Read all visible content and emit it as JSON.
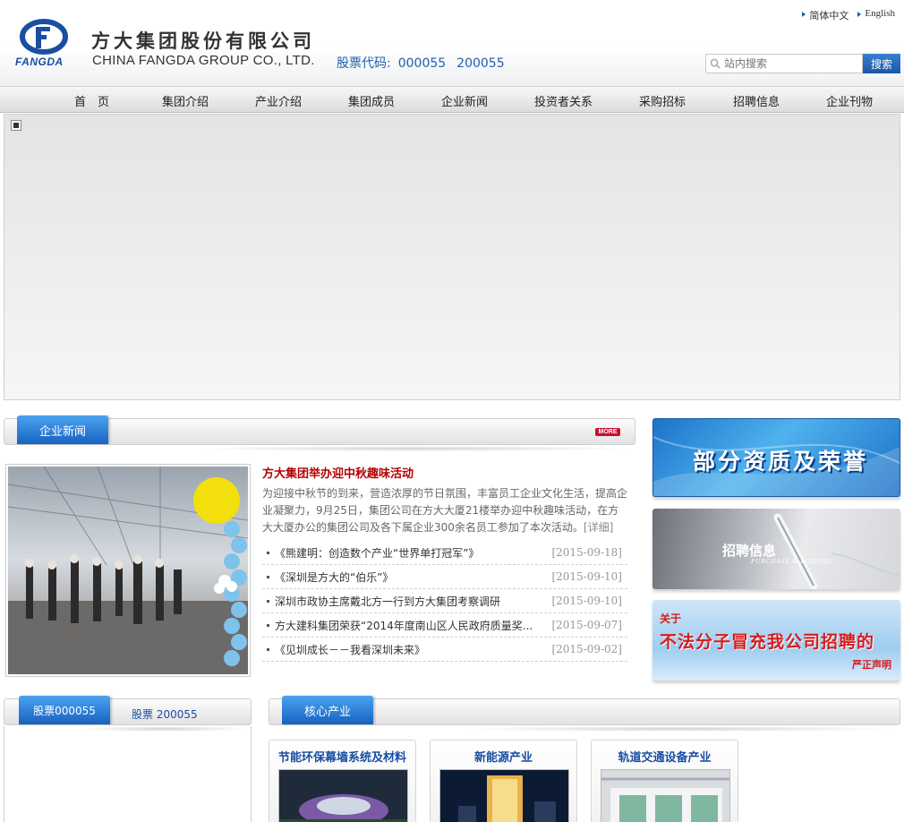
{
  "header": {
    "logo_text": "FANGDA",
    "company_cn": "方大集团股份有限公司",
    "company_en": "CHINA FANGDA GROUP CO., LTD.",
    "stock_label": "股票代码:",
    "stock_a": "000055",
    "stock_b": "200055",
    "lang_cn": "简体中文",
    "lang_en": "English",
    "search_placeholder": "站内搜索",
    "search_button": "搜索",
    "brand_color": "#1a4ea1"
  },
  "nav": {
    "items": [
      "首　页",
      "集团介绍",
      "产业介绍",
      "集团成员",
      "企业新闻",
      "投资者关系",
      "采购招标",
      "招聘信息",
      "企业刊物"
    ]
  },
  "news": {
    "section_title": "企业新闻",
    "more": "MORE",
    "headline": "方大集团举办迎中秋趣味活动",
    "summary": "为迎接中秋节的到来，营造浓厚的节日氛围，丰富员工企业文化生活，提高企业凝聚力，9月25日，集团公司在方大大厦21楼举办迎中秋趣味活动，在方大大厦办公的集团公司及各下属企业300余名员工参加了本次活动。",
    "detail": "[详细]",
    "items": [
      {
        "title": "《熊建明：创造数个产业“世界单打冠军”》",
        "date": "[2015-09-18]"
      },
      {
        "title": "《深圳是方大的“伯乐”》",
        "date": "[2015-09-10]"
      },
      {
        "title": "深圳市政协主席戴北方一行到方大集团考察调研",
        "date": "[2015-09-10]"
      },
      {
        "title": "方大建科集团荣获“2014年度南山区人民政府质量奖...",
        "date": "[2015-09-07]"
      },
      {
        "title": "《见圳成长－－我看深圳未来》",
        "date": "[2015-09-02]"
      }
    ]
  },
  "side_banners": {
    "honors": "部分资质及荣誉",
    "recruit": "招聘信息",
    "recruit_sub": "PURCHASE & BIDDING",
    "notice_top": "关于",
    "notice_main": "不法分子冒充我公司招聘的",
    "notice_bottom": "严正声明"
  },
  "stock": {
    "tab_a": "股票000055",
    "tab_b": "股票  200055"
  },
  "industry": {
    "section_title": "核心产业",
    "cards": [
      "节能环保幕墙系统及材料",
      "新能源产业",
      "轨道交通设备产业"
    ]
  }
}
